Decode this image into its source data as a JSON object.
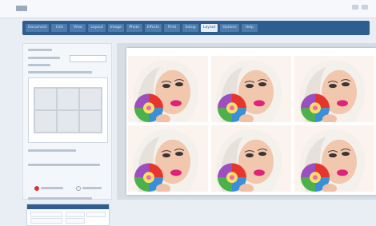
{
  "app": {
    "title": "Photo Print Layout",
    "window_controls": [
      "minimize-icon",
      "close-icon"
    ]
  },
  "tabs": [
    {
      "label": "Document",
      "active": false
    },
    {
      "label": "Edit",
      "active": false
    },
    {
      "label": "View",
      "active": false
    },
    {
      "label": "Layout",
      "active": false
    },
    {
      "label": "Image",
      "active": false
    },
    {
      "label": "Photo",
      "active": false
    },
    {
      "label": "Effects",
      "active": false
    },
    {
      "label": "Print",
      "active": false
    },
    {
      "label": "Setup",
      "active": false
    },
    {
      "label": "Layout",
      "active": true
    },
    {
      "label": "Options",
      "active": false
    },
    {
      "label": "Help",
      "active": false
    }
  ],
  "left_panel": {
    "layout_cells": 6,
    "radio_selected": "first"
  },
  "canvas": {
    "photo_count": 6,
    "accent": "#2e5d8f",
    "radio_color": "#d63636"
  }
}
